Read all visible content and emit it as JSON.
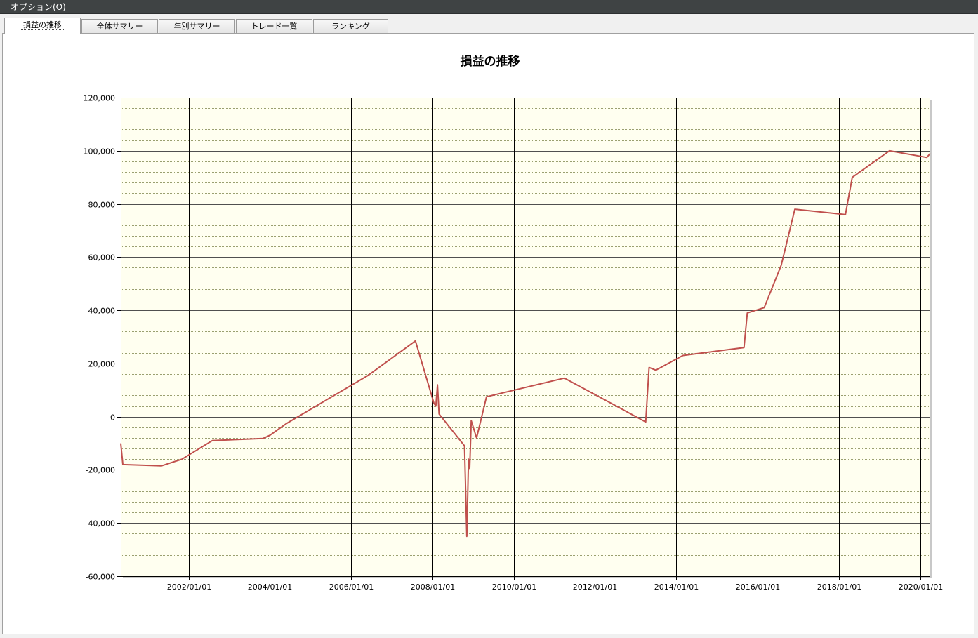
{
  "menu": {
    "option_label": "オプション(O)"
  },
  "tabs": [
    {
      "label": "損益の推移",
      "active": true
    },
    {
      "label": "全体サマリー",
      "active": false
    },
    {
      "label": "年別サマリー",
      "active": false
    },
    {
      "label": "トレード一覧",
      "active": false
    },
    {
      "label": "ランキング",
      "active": false
    }
  ],
  "colors": {
    "plot_background": "#fffff0",
    "line": "#c0504d",
    "menubar": "#3f4344"
  },
  "chart_data": {
    "type": "line",
    "title": "損益の推移",
    "xlabel": "",
    "ylabel": "",
    "ylim": [
      -60000,
      120000
    ],
    "xlim": [
      "2000-05-01",
      "2020-04-01"
    ],
    "y_major_step": 20000,
    "y_minor_step": 4000,
    "grid": true,
    "legend": "none",
    "x_ticks": [
      "2002/01/01",
      "2004/01/01",
      "2006/01/01",
      "2008/01/01",
      "2010/01/01",
      "2012/01/01",
      "2014/01/01",
      "2016/01/01",
      "2018/01/01",
      "2020/01/01"
    ],
    "y_ticks": [
      "120,000",
      "100,000",
      "80,000",
      "60,000",
      "40,000",
      "20,000",
      "0",
      "-20,000",
      "-40,000",
      "-60,000"
    ],
    "series": [
      {
        "points": [
          [
            "2000-05-01",
            -10000
          ],
          [
            "2000-05-20",
            -18000
          ],
          [
            "2001-05-01",
            -18500
          ],
          [
            "2001-11-01",
            -16000
          ],
          [
            "2002-08-01",
            -9000
          ],
          [
            "2003-11-01",
            -8200
          ],
          [
            "2004-01-01",
            -7000
          ],
          [
            "2004-06-01",
            -2500
          ],
          [
            "2006-06-01",
            15500
          ],
          [
            "2007-08-01",
            28500
          ],
          [
            "2008-01-15",
            5000
          ],
          [
            "2008-02-01",
            4000
          ],
          [
            "2008-02-15",
            12000
          ],
          [
            "2008-03-01",
            1000
          ],
          [
            "2008-10-15",
            -11000
          ],
          [
            "2008-11-05",
            -45000
          ],
          [
            "2008-11-20",
            -16000
          ],
          [
            "2008-12-01",
            -19500
          ],
          [
            "2008-12-15",
            -1500
          ],
          [
            "2009-02-01",
            -8000
          ],
          [
            "2009-05-01",
            7500
          ],
          [
            "2011-04-01",
            14500
          ],
          [
            "2013-04-01",
            -2000
          ],
          [
            "2013-05-01",
            18500
          ],
          [
            "2013-07-01",
            17500
          ],
          [
            "2014-03-01",
            23000
          ],
          [
            "2015-09-01",
            26000
          ],
          [
            "2015-10-01",
            39000
          ],
          [
            "2016-03-01",
            41000
          ],
          [
            "2016-08-01",
            57000
          ],
          [
            "2016-12-01",
            78000
          ],
          [
            "2018-03-01",
            76000
          ],
          [
            "2018-05-01",
            90000
          ],
          [
            "2019-04-01",
            100000
          ],
          [
            "2020-03-01",
            97500
          ],
          [
            "2020-04-01",
            99000
          ]
        ]
      }
    ]
  }
}
